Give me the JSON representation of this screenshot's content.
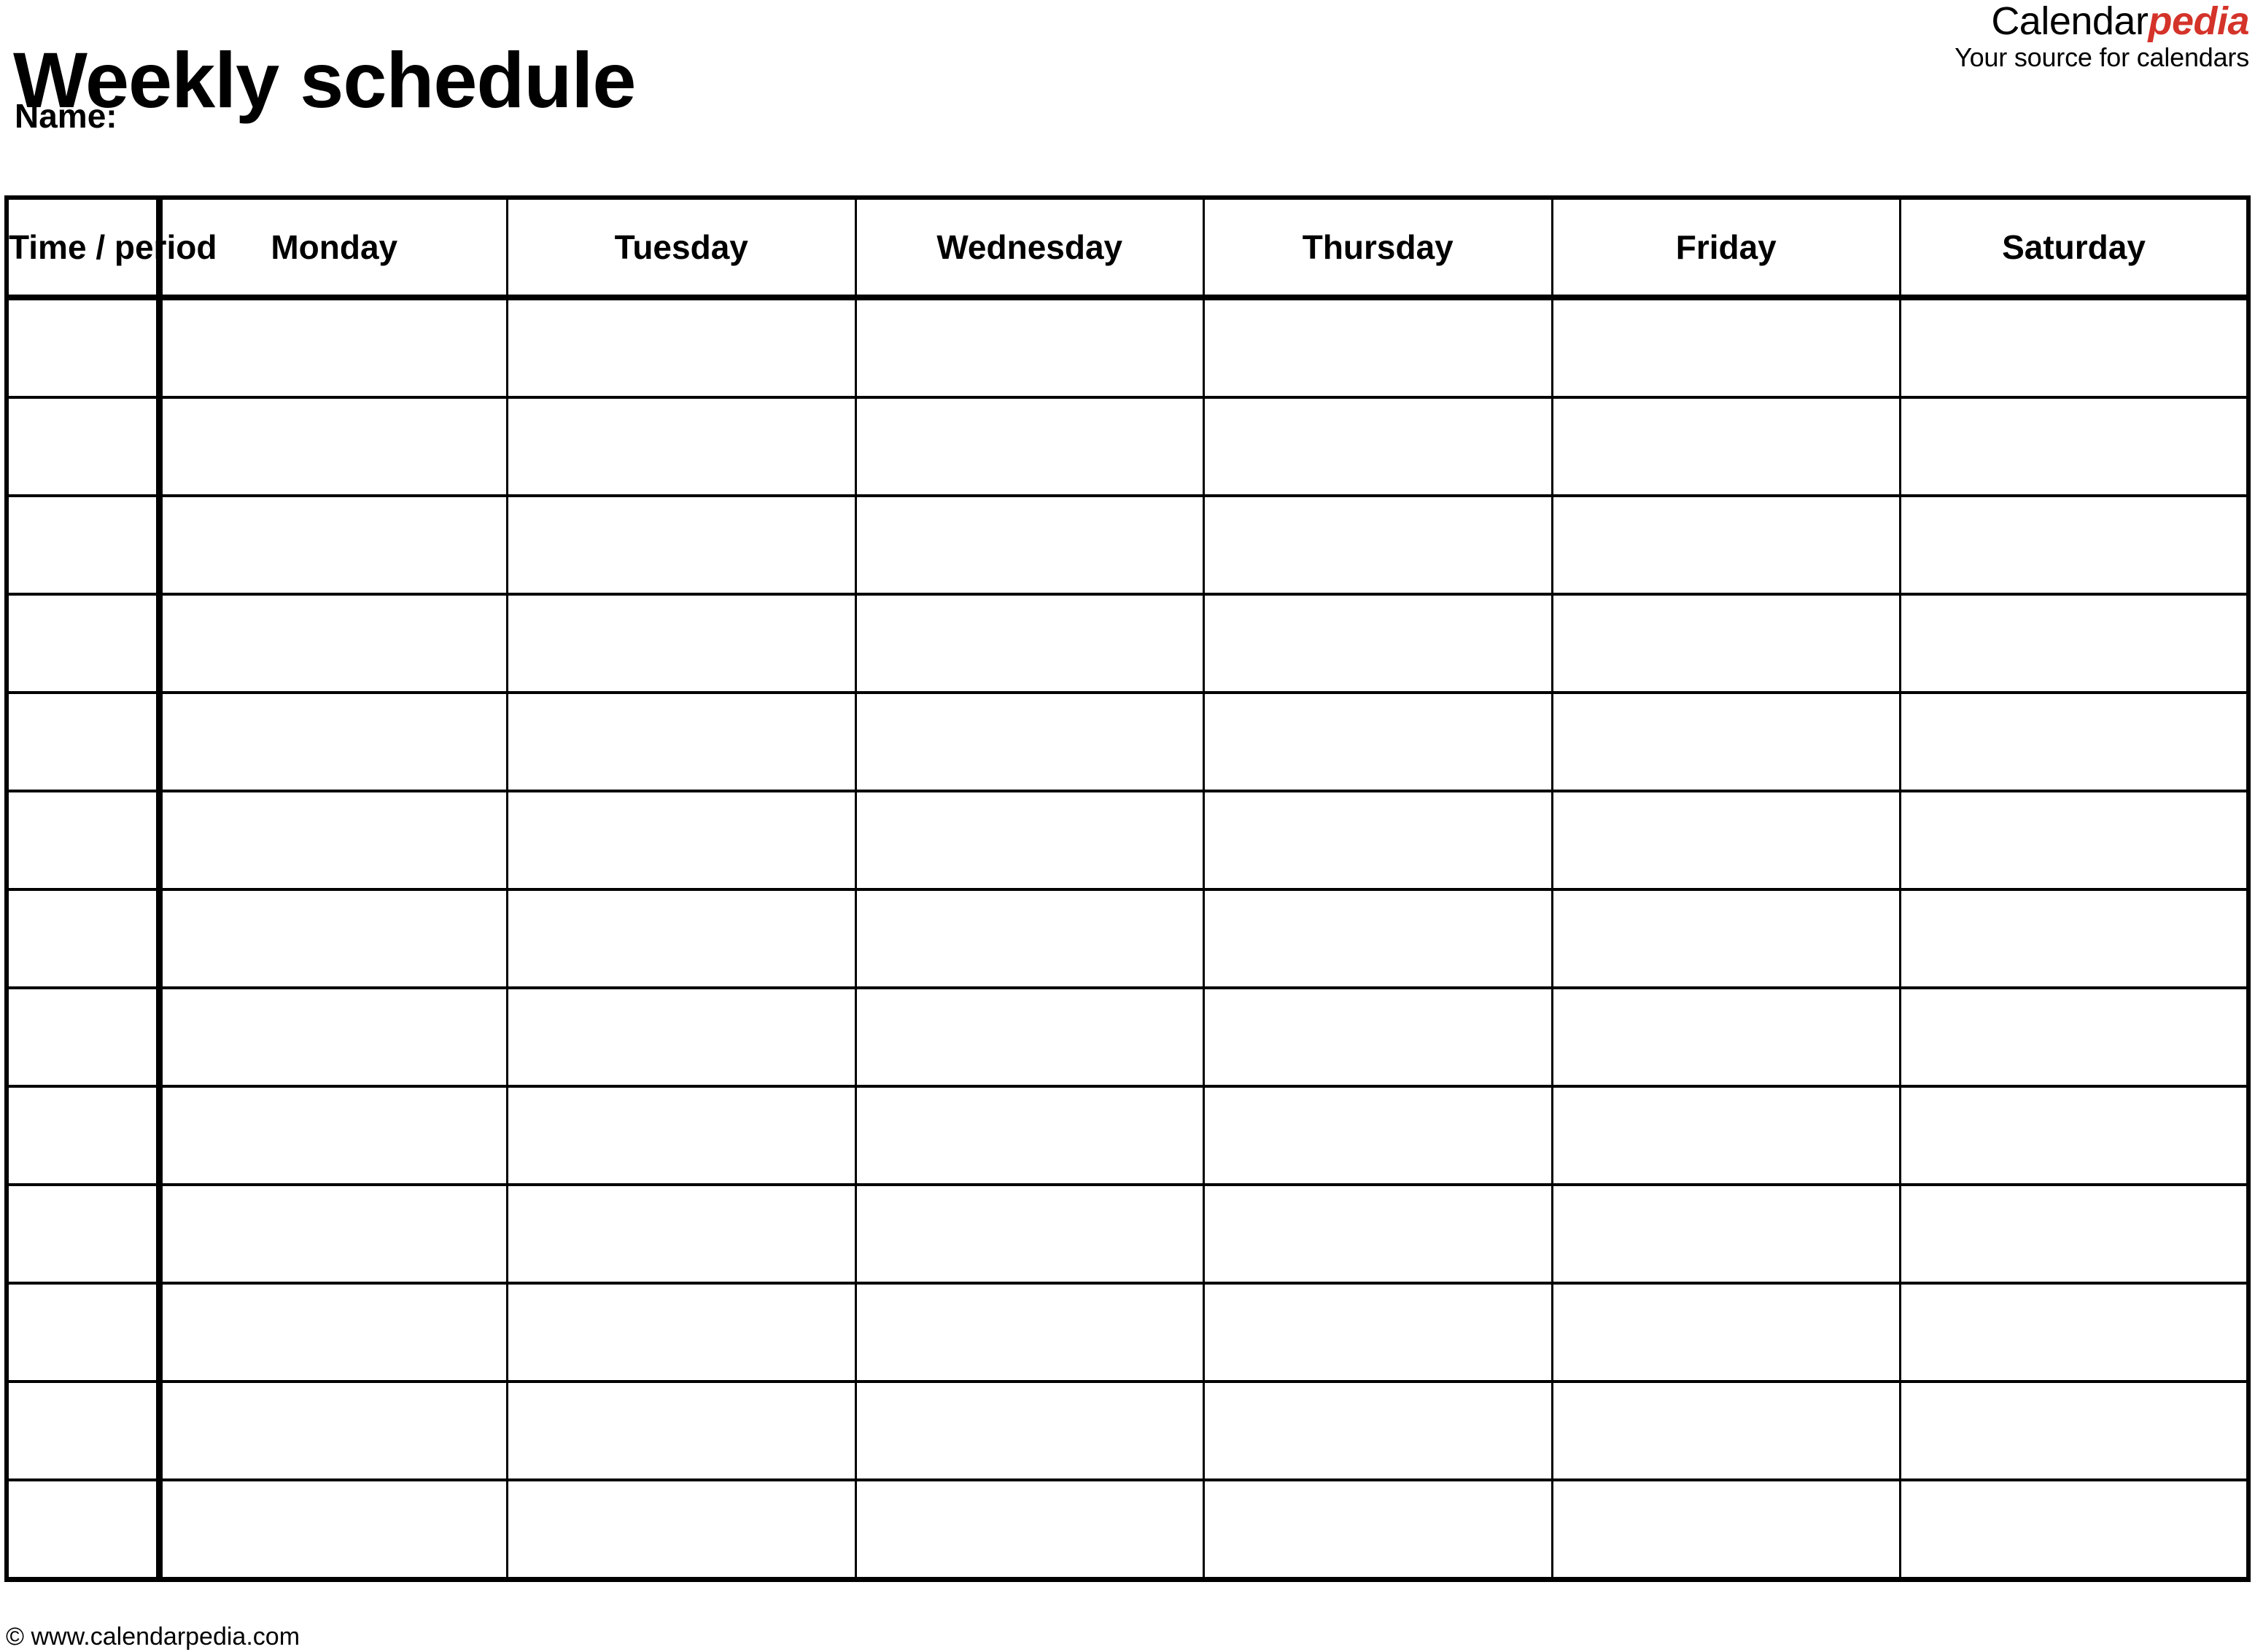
{
  "document": {
    "title": "Weekly schedule",
    "name_label": "Name:"
  },
  "logo": {
    "brand_part1": "Calendar",
    "brand_part2": "pedia",
    "tagline": "Your source for calendars",
    "accent_color": "#D4332A"
  },
  "schedule": {
    "columns": [
      {
        "key": "time",
        "label": "Time / period"
      },
      {
        "key": "mon",
        "label": "Monday"
      },
      {
        "key": "tue",
        "label": "Tuesday"
      },
      {
        "key": "wed",
        "label": "Wednesday"
      },
      {
        "key": "thu",
        "label": "Thursday"
      },
      {
        "key": "fri",
        "label": "Friday"
      },
      {
        "key": "sat",
        "label": "Saturday"
      }
    ],
    "row_count": 13,
    "rows": [
      {
        "time": "",
        "mon": "",
        "tue": "",
        "wed": "",
        "thu": "",
        "fri": "",
        "sat": ""
      },
      {
        "time": "",
        "mon": "",
        "tue": "",
        "wed": "",
        "thu": "",
        "fri": "",
        "sat": ""
      },
      {
        "time": "",
        "mon": "",
        "tue": "",
        "wed": "",
        "thu": "",
        "fri": "",
        "sat": ""
      },
      {
        "time": "",
        "mon": "",
        "tue": "",
        "wed": "",
        "thu": "",
        "fri": "",
        "sat": ""
      },
      {
        "time": "",
        "mon": "",
        "tue": "",
        "wed": "",
        "thu": "",
        "fri": "",
        "sat": ""
      },
      {
        "time": "",
        "mon": "",
        "tue": "",
        "wed": "",
        "thu": "",
        "fri": "",
        "sat": ""
      },
      {
        "time": "",
        "mon": "",
        "tue": "",
        "wed": "",
        "thu": "",
        "fri": "",
        "sat": ""
      },
      {
        "time": "",
        "mon": "",
        "tue": "",
        "wed": "",
        "thu": "",
        "fri": "",
        "sat": ""
      },
      {
        "time": "",
        "mon": "",
        "tue": "",
        "wed": "",
        "thu": "",
        "fri": "",
        "sat": ""
      },
      {
        "time": "",
        "mon": "",
        "tue": "",
        "wed": "",
        "thu": "",
        "fri": "",
        "sat": ""
      },
      {
        "time": "",
        "mon": "",
        "tue": "",
        "wed": "",
        "thu": "",
        "fri": "",
        "sat": ""
      },
      {
        "time": "",
        "mon": "",
        "tue": "",
        "wed": "",
        "thu": "",
        "fri": "",
        "sat": ""
      },
      {
        "time": "",
        "mon": "",
        "tue": "",
        "wed": "",
        "thu": "",
        "fri": "",
        "sat": ""
      }
    ]
  },
  "footer": {
    "credit": "© www.calendarpedia.com"
  }
}
